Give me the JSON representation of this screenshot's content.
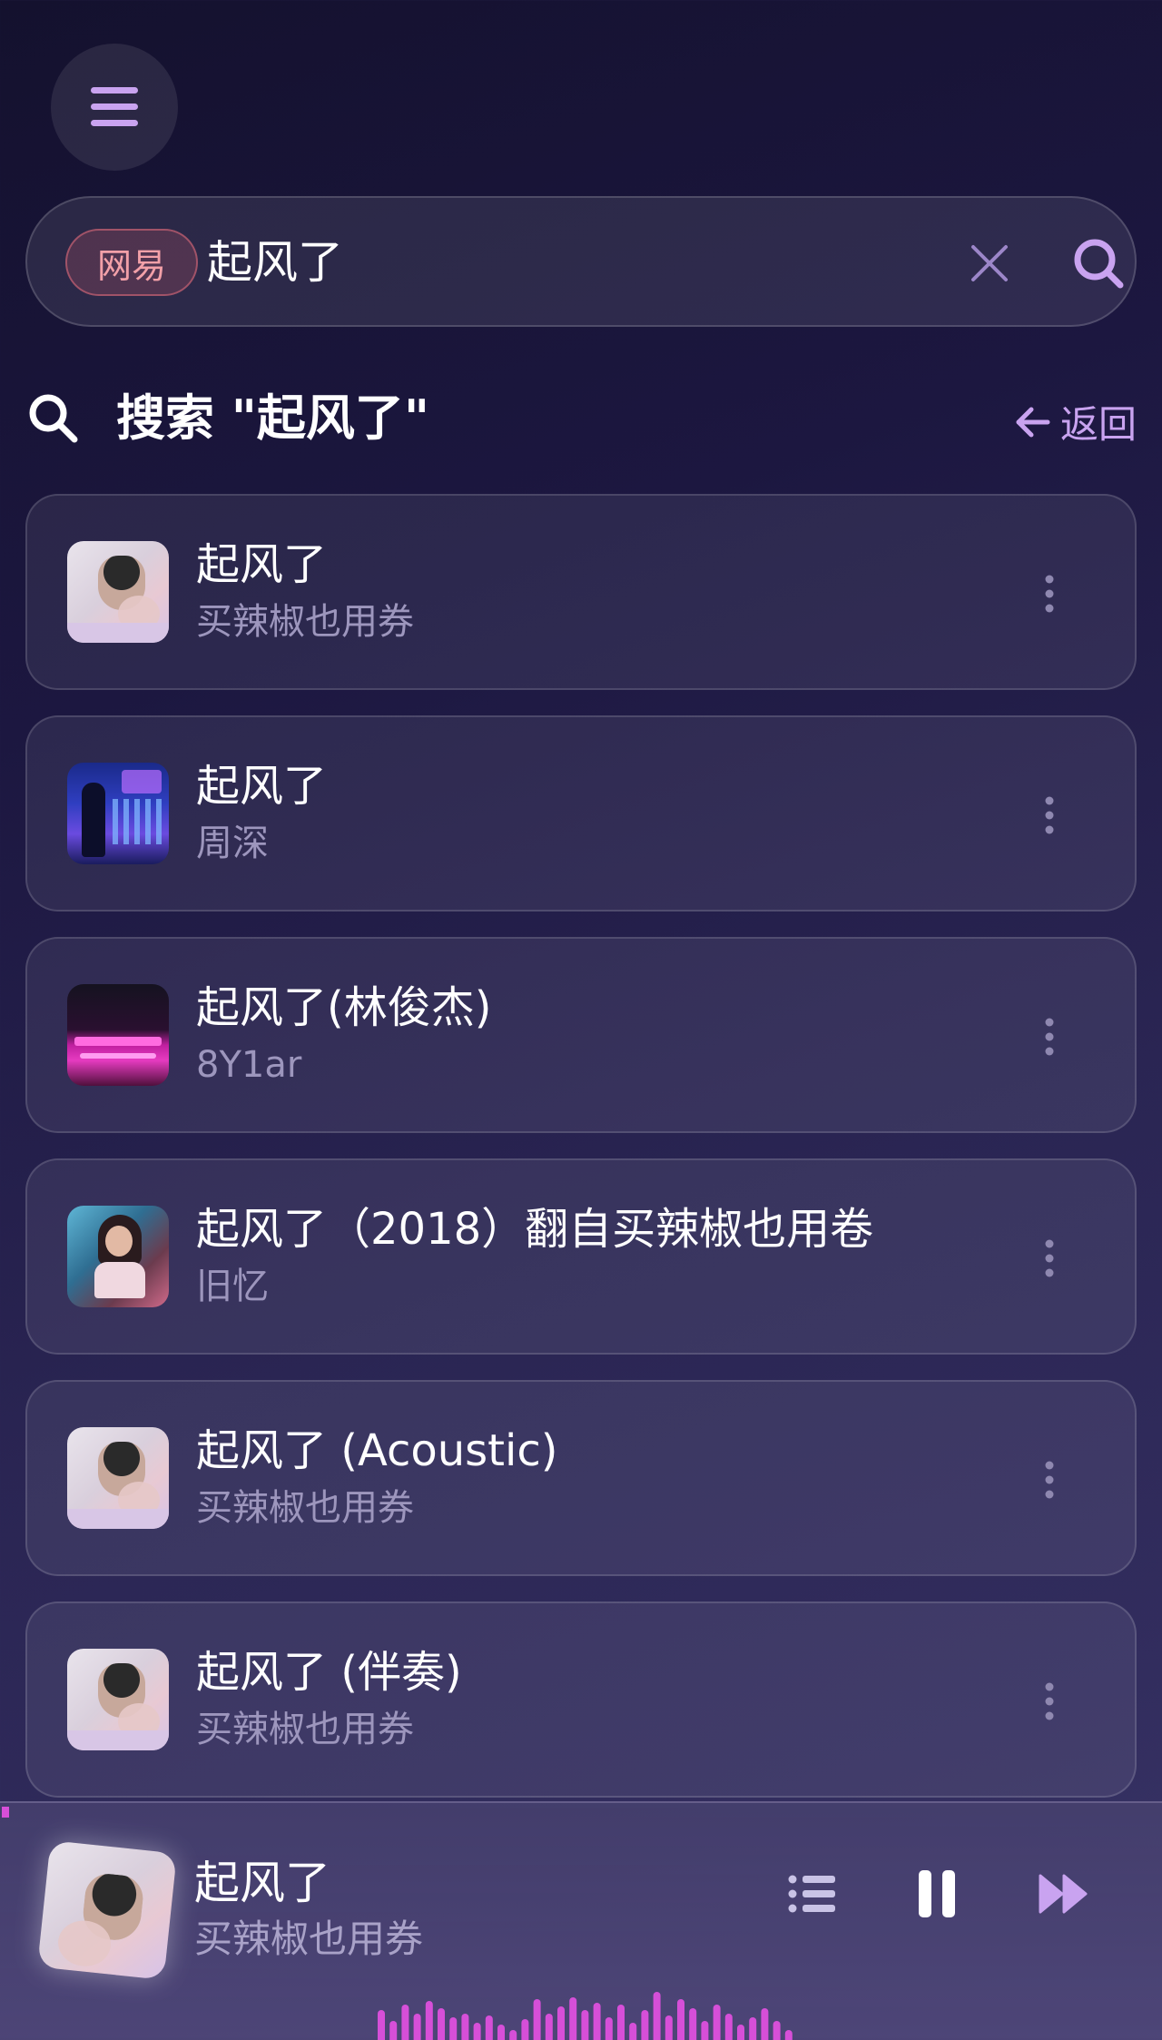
{
  "search": {
    "source_tag": "网易",
    "value": "起风了"
  },
  "results_header": {
    "title": "搜索 \"起风了\"",
    "back_label": "返回"
  },
  "songs": [
    {
      "title": "起风了",
      "artist": "买辣椒也用券",
      "cover": "cover-a"
    },
    {
      "title": "起风了",
      "artist": "周深",
      "cover": "cover-b"
    },
    {
      "title": "起风了(林俊杰)",
      "artist": "8Y1ar",
      "cover": "cover-c"
    },
    {
      "title": "起风了（2018）翻自买辣椒也用卷",
      "artist": "旧忆",
      "cover": "cover-d"
    },
    {
      "title": "起风了 (Acoustic)",
      "artist": "买辣椒也用券",
      "cover": "cover-a"
    },
    {
      "title": "起风了 (伴奏)",
      "artist": "买辣椒也用券",
      "cover": "cover-a"
    }
  ],
  "player": {
    "title": "起风了",
    "artist": "买辣椒也用券",
    "state": "playing"
  },
  "icons": {
    "menu": "hamburger-menu-icon",
    "clear": "close-icon",
    "search": "search-icon",
    "back": "arrow-left-icon",
    "more": "more-vertical-icon",
    "playlist": "playlist-icon",
    "pause": "pause-icon",
    "next": "fast-forward-icon"
  },
  "colors": {
    "accent": "#c9a3f0",
    "source_tag": "#f2a0a8",
    "secondary_text": "#9d96bd",
    "visualizer": "#d64fd8"
  }
}
